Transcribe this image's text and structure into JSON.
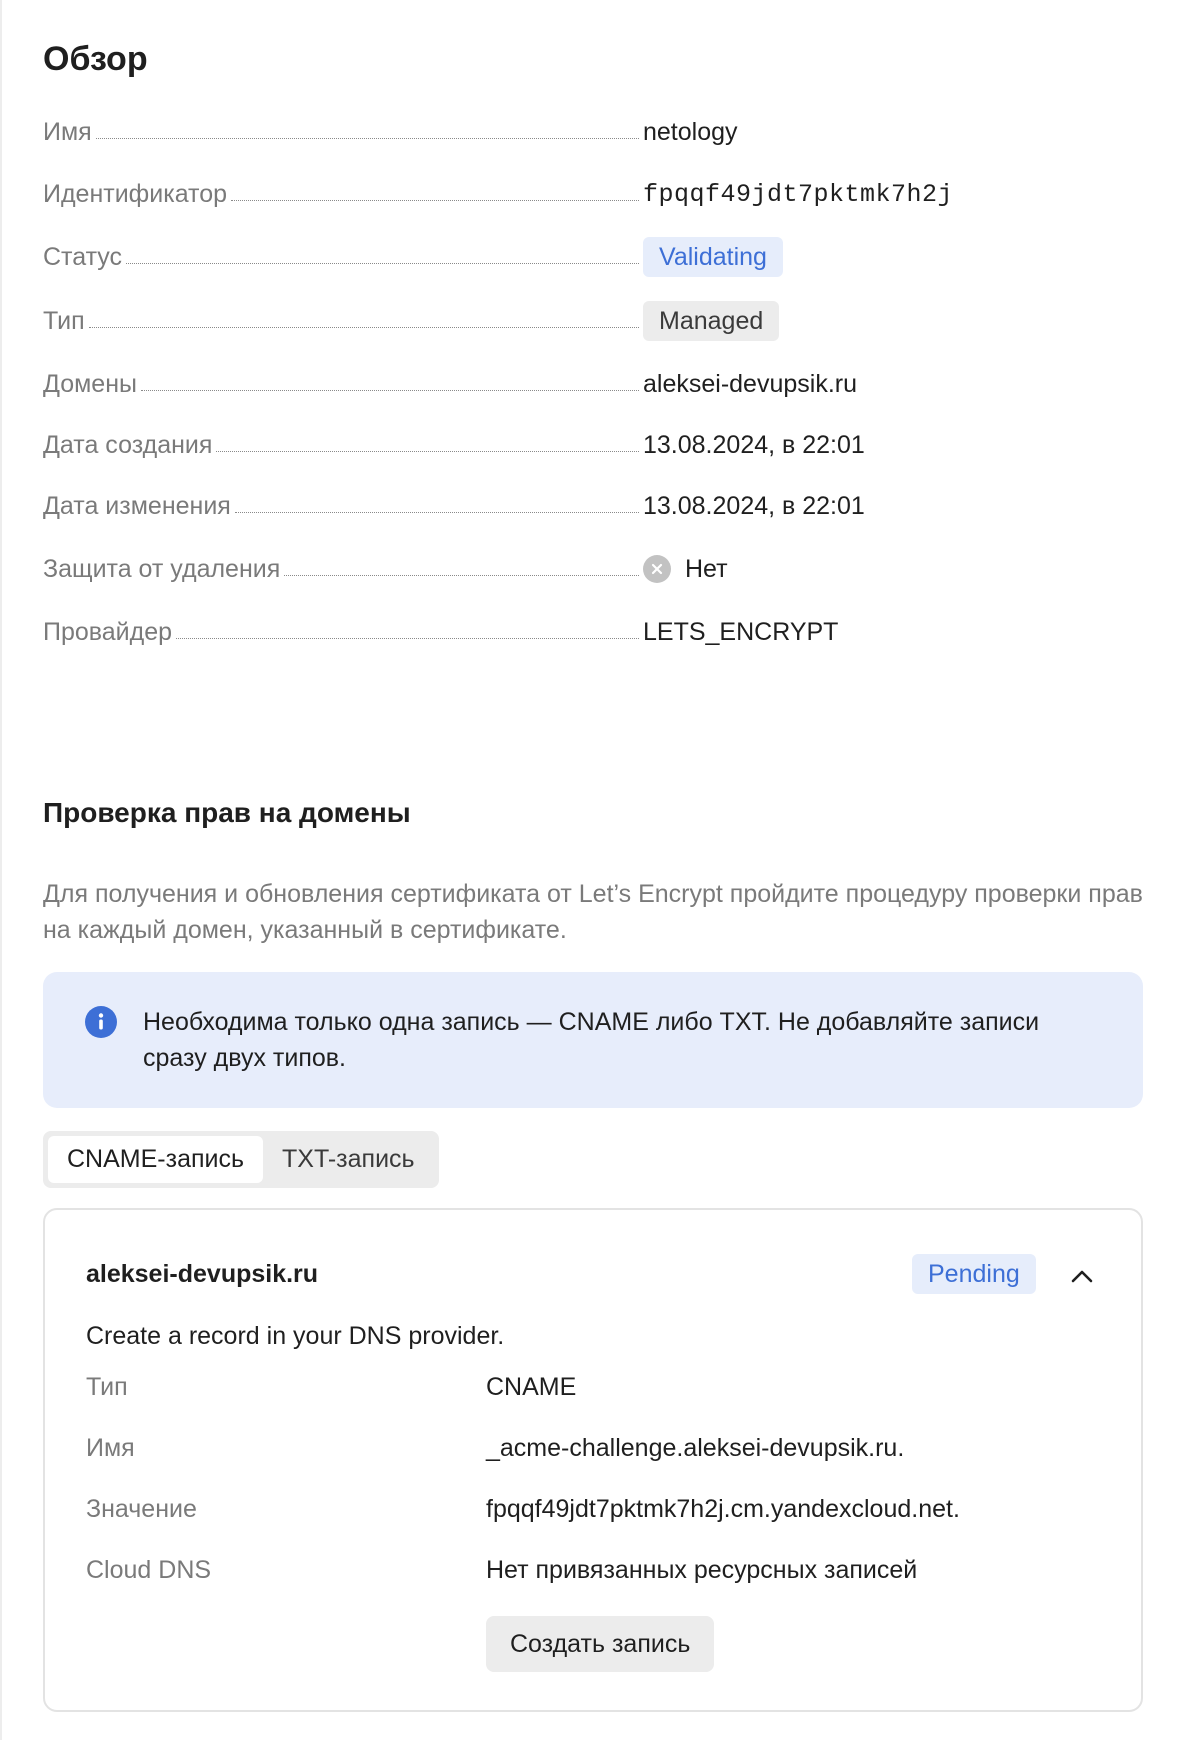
{
  "page": {
    "title": "Обзор"
  },
  "overview": {
    "name_label": "Имя",
    "name_value": "netology",
    "id_label": "Идентификатор",
    "id_value": "fpqqf49jdt7pktmk7h2j",
    "status_label": "Статус",
    "status_value": "Validating",
    "type_label": "Тип",
    "type_value": "Managed",
    "domains_label": "Домены",
    "domains_value": "aleksei-devupsik.ru",
    "created_label": "Дата создания",
    "created_value": "13.08.2024, в 22:01",
    "modified_label": "Дата изменения",
    "modified_value": "13.08.2024, в 22:01",
    "protection_label": "Защита от удаления",
    "protection_value": "Нет",
    "provider_label": "Провайдер",
    "provider_value": "LETS_ENCRYPT"
  },
  "domain_check": {
    "title": "Проверка прав на домены",
    "description": "Для получения и обновления сертификата от Let’s Encrypt пройдите процедуру проверки прав на каждый домен, указанный в сертификате.",
    "info_text": "Необходима только одна запись — CNAME либо TXT. Не добавляйте записи сразу двух типов.",
    "tabs": [
      {
        "label": "CNAME-запись",
        "active": true
      },
      {
        "label": "TXT-запись",
        "active": false
      }
    ]
  },
  "record_card": {
    "domain": "aleksei-devupsik.ru",
    "status": "Pending",
    "hint": "Create a record in your DNS provider.",
    "type_label": "Тип",
    "type_value": "CNAME",
    "name_label": "Имя",
    "name_value": "_acme-challenge.aleksei-devupsik.ru.",
    "value_label": "Значение",
    "value_value": "fpqqf49jdt7pktmk7h2j.cm.yandexcloud.net.",
    "cloud_dns_label": "Cloud DNS",
    "cloud_dns_value": "Нет привязанных ресурсных записей",
    "create_button": "Создать запись"
  },
  "colors": {
    "accent": "#3d6fd6",
    "info_bg": "#e7edfb",
    "muted_text": "#7a7a7a",
    "chip_neutral": "#ececec"
  },
  "icons": [
    "close-circle-icon",
    "info-icon",
    "chevron-up-icon"
  ]
}
